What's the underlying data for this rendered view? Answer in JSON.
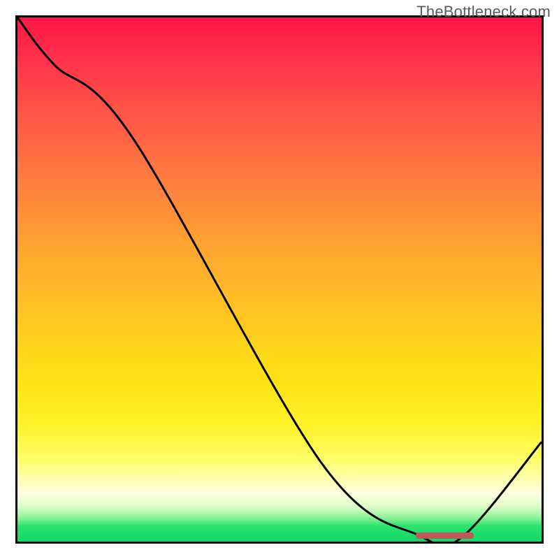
{
  "watermark": "TheBottleneck.com",
  "chart_data": {
    "type": "line",
    "title": "",
    "xlabel": "",
    "ylabel": "",
    "xlim": [
      0,
      100
    ],
    "ylim": [
      0,
      100
    ],
    "x": [
      0,
      7,
      22,
      58,
      77,
      85,
      100
    ],
    "values": [
      100,
      91,
      77,
      15,
      1,
      1,
      19
    ],
    "minimum_band": {
      "x_start": 76,
      "x_end": 87,
      "y": 1.2
    },
    "background_gradient_stops": [
      {
        "pct": 0,
        "color": "#ff1544"
      },
      {
        "pct": 6,
        "color": "#ff2b4a"
      },
      {
        "pct": 18,
        "color": "#ff5548"
      },
      {
        "pct": 30,
        "color": "#ff7a3f"
      },
      {
        "pct": 44,
        "color": "#ffa531"
      },
      {
        "pct": 58,
        "color": "#ffc91f"
      },
      {
        "pct": 70,
        "color": "#ffe414"
      },
      {
        "pct": 78,
        "color": "#fff22a"
      },
      {
        "pct": 84,
        "color": "#ffff66"
      },
      {
        "pct": 88,
        "color": "#ffffb0"
      },
      {
        "pct": 91,
        "color": "#fdffe2"
      },
      {
        "pct": 93.5,
        "color": "#d8fcc4"
      },
      {
        "pct": 95.5,
        "color": "#8bf296"
      },
      {
        "pct": 97,
        "color": "#2ae46e"
      },
      {
        "pct": 100,
        "color": "#11d76b"
      }
    ]
  }
}
